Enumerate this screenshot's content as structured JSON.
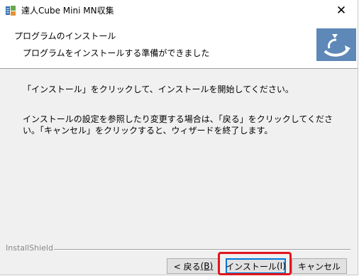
{
  "window": {
    "title": "達人Cube Mini MN収集",
    "close_glyph": "✕"
  },
  "header": {
    "title": "プログラムのインストール",
    "subtitle": "プログラムをインストールする準備ができました"
  },
  "body": {
    "paragraph1": "「インストール」をクリックして、インストールを開始してください。",
    "paragraph2": "インストールの設定を参照したり変更する場合は、「戻る」をクリックしてください。「キャンセル」をクリックすると、ウィザードを終了します。"
  },
  "footer": {
    "brand": "InstallShield"
  },
  "buttons": {
    "back_label": "< 戻る",
    "back_accel": "(B)",
    "install_label": "インストール",
    "install_accel": "(I)",
    "cancel_label": "キャンセル"
  },
  "colors": {
    "highlight": "#e0161b",
    "logo_bg": "#5e88b8",
    "focus": "#0078d7"
  }
}
